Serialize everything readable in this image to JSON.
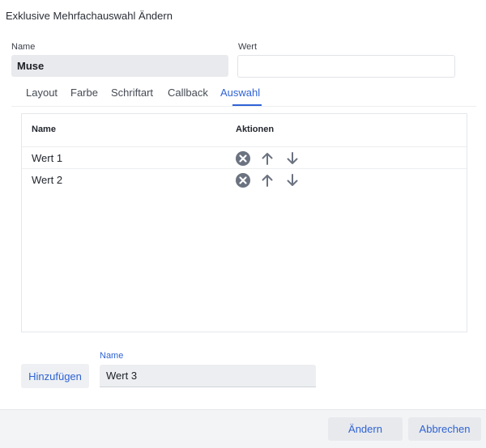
{
  "dialog": {
    "title": "Exklusive Mehrfachauswahl  Ändern"
  },
  "fields": {
    "name_label": "Name",
    "name_value": "Muse",
    "value_label": "Wert",
    "value_value": ""
  },
  "tabs": [
    {
      "label": "Layout",
      "active": false
    },
    {
      "label": "Farbe",
      "active": false
    },
    {
      "label": "Schriftart",
      "active": false
    },
    {
      "label": "Callback",
      "active": false
    },
    {
      "label": "Auswahl",
      "active": true
    }
  ],
  "table": {
    "headers": {
      "name": "Name",
      "actions": "Aktionen"
    },
    "rows": [
      {
        "label": "Wert 1",
        "actions": [
          "remove-circle-icon",
          "arrow-up-icon",
          "arrow-down-icon"
        ]
      },
      {
        "label": "Wert 2",
        "actions": [
          "remove-circle-icon",
          "arrow-up-icon",
          "arrow-down-icon"
        ]
      }
    ]
  },
  "add_section": {
    "button_label": "Hinzufügen",
    "name_label": "Name",
    "name_value": "Wert 3"
  },
  "footer": {
    "apply_label": "Ändern",
    "cancel_label": "Abbrechen"
  },
  "colors": {
    "accent": "#2f63d4",
    "icon": "#6b7280"
  }
}
